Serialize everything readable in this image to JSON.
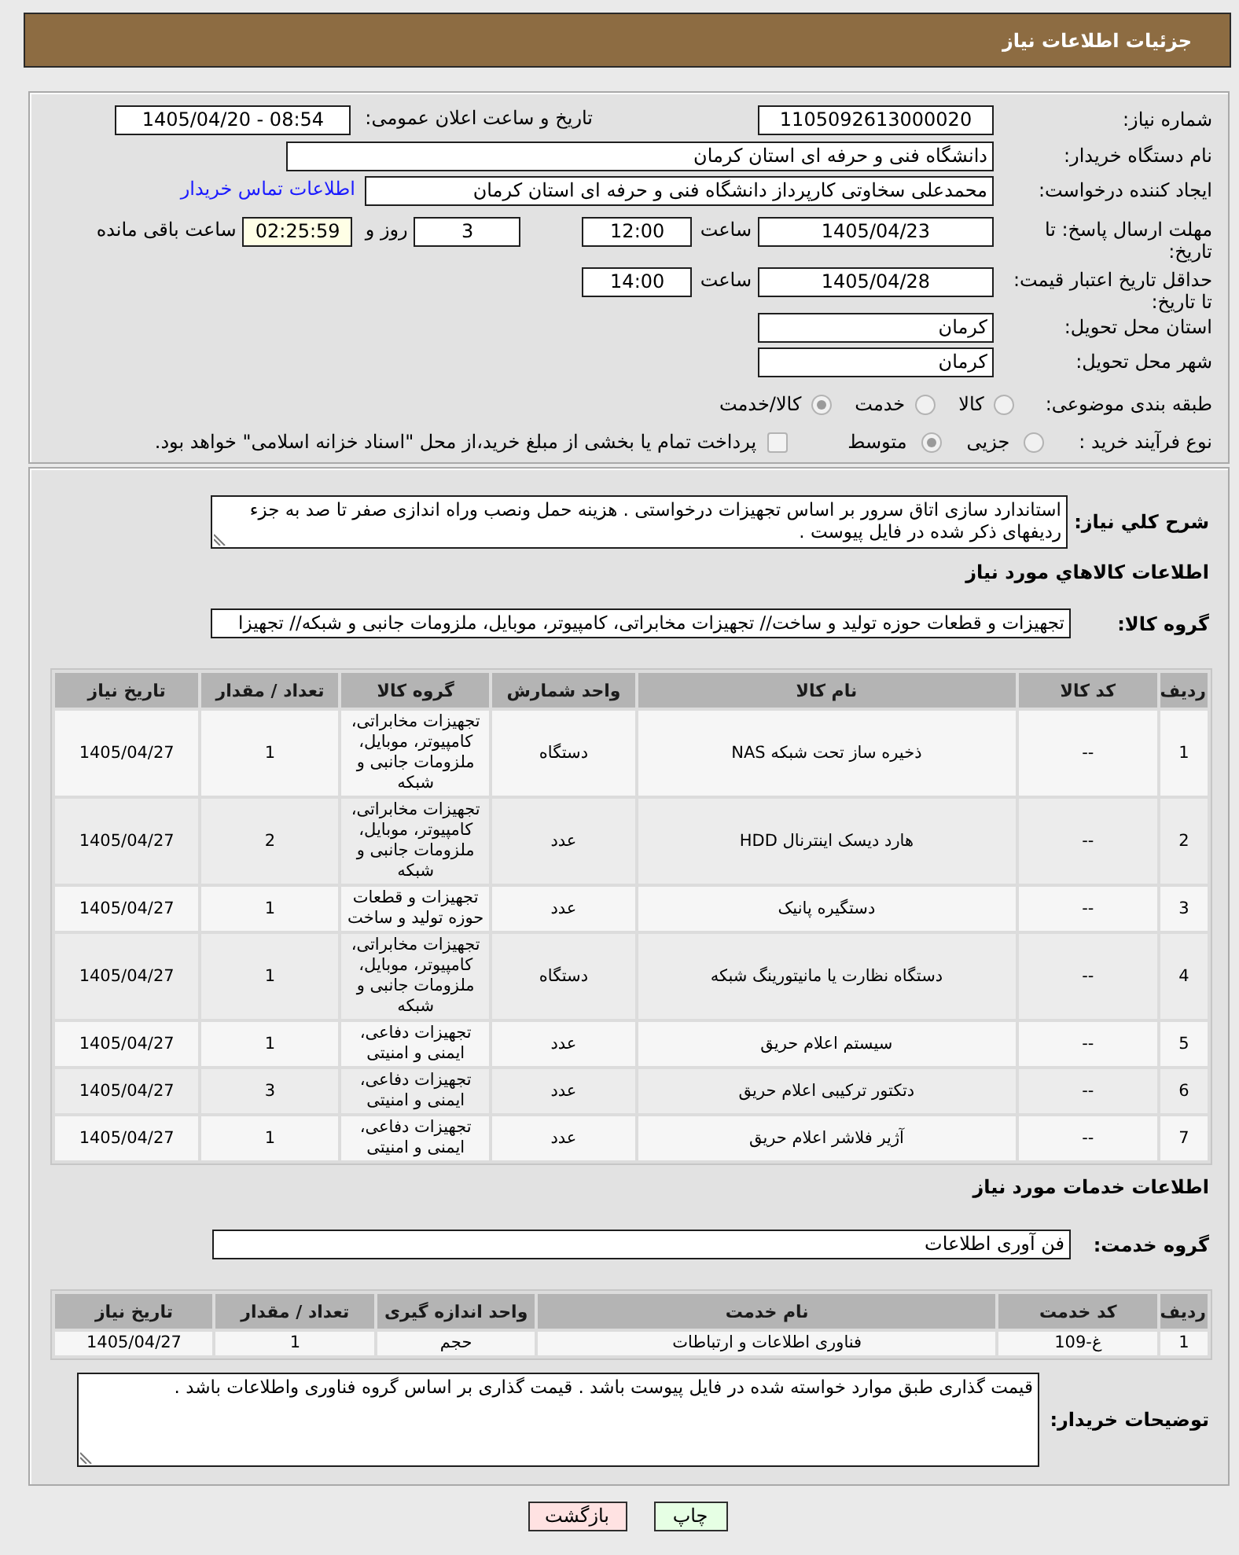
{
  "header": {
    "title": "جزئیات اطلاعات نیاز"
  },
  "need_info": {
    "need_number": {
      "label": "شماره نیاز:",
      "value": "1105092613000020"
    },
    "announcement": {
      "label": "تاریخ و ساعت اعلان عمومی:",
      "value": "1405/04/20 - 08:54"
    },
    "buyer_org": {
      "label": "نام دستگاه خریدار:",
      "value": "دانشگاه فنی و حرفه ای استان کرمان"
    },
    "requester": {
      "label": "ایجاد کننده درخواست:",
      "value": "محمدعلی سخاوتی کارپرداز دانشگاه فنی و حرفه ای استان کرمان",
      "contact_link": "اطلاعات تماس خریدار"
    },
    "reply_deadline": {
      "label": "مهلت ارسال پاسخ: تا تاریخ:",
      "date": "1405/04/23",
      "time_label": "ساعت",
      "time": "12:00",
      "days": "3",
      "days_label": "روز و",
      "remaining": "02:25:59",
      "remaining_label": "ساعت باقی مانده"
    },
    "price_validity": {
      "label": "حداقل تاریخ اعتبار قیمت: تا تاریخ:",
      "date": "1405/04/28",
      "time_label": "ساعت",
      "time": "14:00"
    },
    "delivery_province": {
      "label": "استان محل تحویل:",
      "value": "کرمان"
    },
    "delivery_city": {
      "label": "شهر محل تحویل:",
      "value": "کرمان"
    },
    "subject_category": {
      "label": "طبقه بندی موضوعی:",
      "options": [
        {
          "label": "کالا",
          "selected": false
        },
        {
          "label": "خدمت",
          "selected": false
        },
        {
          "label": "کالا/خدمت",
          "selected": true
        }
      ]
    },
    "purchase_process": {
      "label": "نوع فرآیند خرید :",
      "options": [
        {
          "label": "جزیی",
          "selected": false
        },
        {
          "label": "متوسط",
          "selected": true
        }
      ],
      "treasury_payment": {
        "label": "پرداخت تمام یا بخشی از مبلغ خرید،از محل \"اسناد خزانه اسلامی\" خواهد بود.",
        "checked": false
      }
    }
  },
  "description": {
    "label": "شرح کلي نیاز:",
    "value": "استاندارد سازی اتاق سرور بر اساس تجهیزات درخواستی . هزینه حمل ونصب وراه اندازی صفر تا صد به  جزء ردیفهای ذکر شده در فایل پیوست ."
  },
  "goods": {
    "heading": "اطلاعات کالاهاي مورد نياز",
    "group_label": "گروه کالا:",
    "group_value": "تجهیزات و قطعات حوزه تولید و ساخت// تجهیزات مخابراتی، کامپیوتر، موبایل، ملزومات جانبی و شبکه// تجهیزا",
    "table": {
      "columns": [
        "ردیف",
        "کد کالا",
        "نام کالا",
        "واحد شمارش",
        "گروه کالا",
        "تعداد / مقدار",
        "تاریخ نیاز"
      ],
      "rows": [
        [
          "1",
          "--",
          "ذخیره ساز تحت شبکه NAS",
          "دستگاه",
          "تجهیزات مخابراتی، کامپیوتر، موبایل، ملزومات جانبی و شبکه",
          "1",
          "1405/04/27"
        ],
        [
          "2",
          "--",
          "هارد دیسک اینترنال HDD",
          "عدد",
          "تجهیزات مخابراتی، کامپیوتر، موبایل، ملزومات جانبی و شبکه",
          "2",
          "1405/04/27"
        ],
        [
          "3",
          "--",
          "دستگیره پانیک",
          "عدد",
          "تجهیزات و قطعات حوزه تولید و ساخت",
          "1",
          "1405/04/27"
        ],
        [
          "4",
          "--",
          "دستگاه نظارت یا مانیتورینگ شبکه",
          "دستگاه",
          "تجهیزات مخابراتی، کامپیوتر، موبایل، ملزومات جانبی و شبکه",
          "1",
          "1405/04/27"
        ],
        [
          "5",
          "--",
          "سیستم اعلام حریق",
          "عدد",
          "تجهیزات دفاعی، ایمنی و امنیتی",
          "1",
          "1405/04/27"
        ],
        [
          "6",
          "--",
          "دتکتور ترکیبی اعلام حریق",
          "عدد",
          "تجهیزات دفاعی، ایمنی و امنیتی",
          "3",
          "1405/04/27"
        ],
        [
          "7",
          "--",
          "آژیر فلاشر اعلام حریق",
          "عدد",
          "تجهیزات دفاعی، ایمنی و امنیتی",
          "1",
          "1405/04/27"
        ]
      ]
    }
  },
  "services": {
    "heading": "اطلاعات خدمات مورد نياز",
    "group_label": "گروه خدمت:",
    "group_value": "فن آوری اطلاعات",
    "table": {
      "columns": [
        "ردیف",
        "کد خدمت",
        "نام خدمت",
        "واحد اندازه گیری",
        "تعداد / مقدار",
        "تاریخ نیاز"
      ],
      "rows": [
        [
          "1",
          "غ-109",
          "فناوری اطلاعات و ارتباطات",
          "حجم",
          "1",
          "1405/04/27"
        ]
      ]
    }
  },
  "buyer_notes": {
    "label": "توضیحات خریدار:",
    "value": "قیمت گذاری طبق موارد خواسته شده در فایل پیوست باشد . قیمت گذاری بر اساس گروه فناوری واطلاعات باشد ."
  },
  "buttons": [
    {
      "label": "چاپ",
      "kind": "print"
    },
    {
      "label": "بازگشت",
      "kind": "back"
    }
  ]
}
